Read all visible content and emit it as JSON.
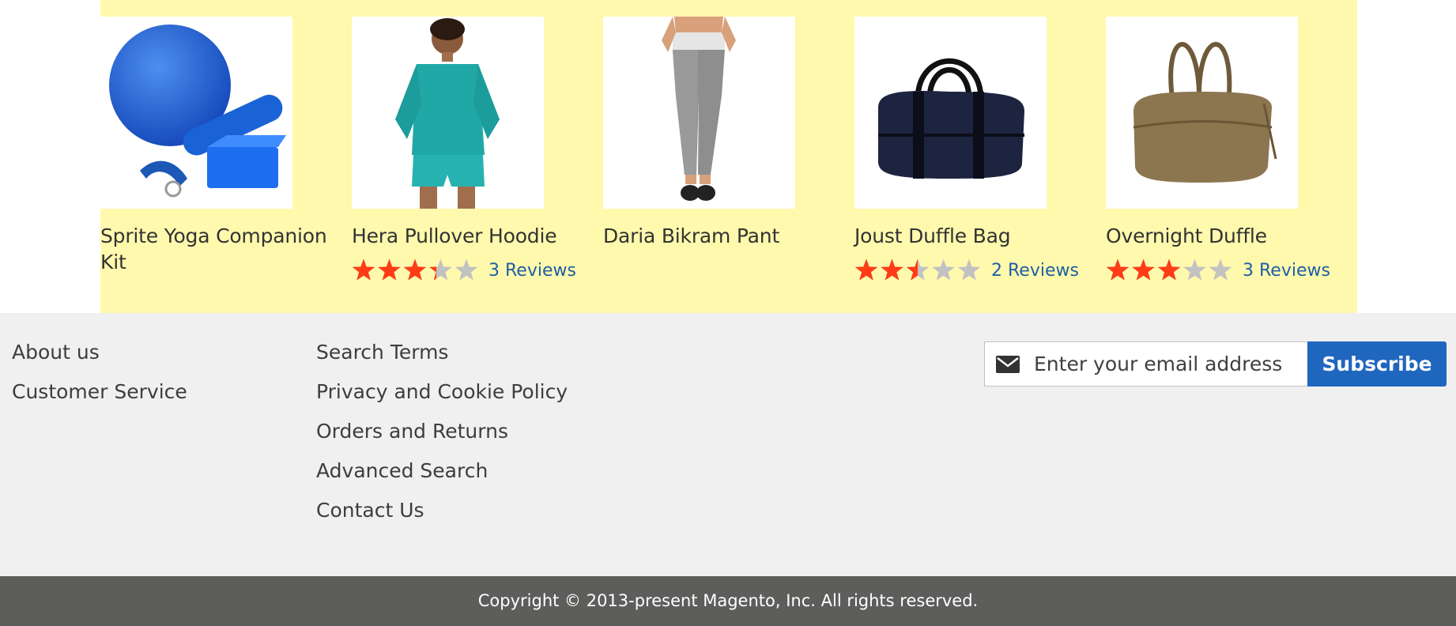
{
  "colors": {
    "band_bg": "#fff9ad",
    "footer_bg": "#f0f0f0",
    "copyright_bg": "#5d5e5c",
    "star_filled": "#ff3c16",
    "star_empty": "#c2c2c2",
    "link": "#1f5ea6",
    "subscribe_bg": "#1f66bf"
  },
  "products": [
    {
      "name": "Sprite Yoga Companion Kit",
      "image": "yoga-kit-image",
      "rating": null,
      "reviews": ""
    },
    {
      "name": "Hera Pullover Hoodie",
      "image": "hoodie-image",
      "rating": 0.67,
      "reviews": "3 Reviews"
    },
    {
      "name": "Daria Bikram Pant",
      "image": "pant-image",
      "rating": null,
      "reviews": ""
    },
    {
      "name": "Joust Duffle Bag",
      "image": "duffle-bag-image",
      "rating": 0.5,
      "reviews": "2 Reviews"
    },
    {
      "name": "Overnight Duffle",
      "image": "overnight-duffle-image",
      "rating": 0.6,
      "reviews": "3 Reviews"
    }
  ],
  "footer": {
    "links_col1": [
      "About us",
      "Customer Service"
    ],
    "links_col2": [
      "Search Terms",
      "Privacy and Cookie Policy",
      "Orders and Returns",
      "Advanced Search",
      "Contact Us"
    ],
    "newsletter": {
      "placeholder": "Enter your email address",
      "button": "Subscribe",
      "icon": "envelope-icon"
    },
    "copyright": "Copyright © 2013-present Magento, Inc. All rights reserved."
  }
}
